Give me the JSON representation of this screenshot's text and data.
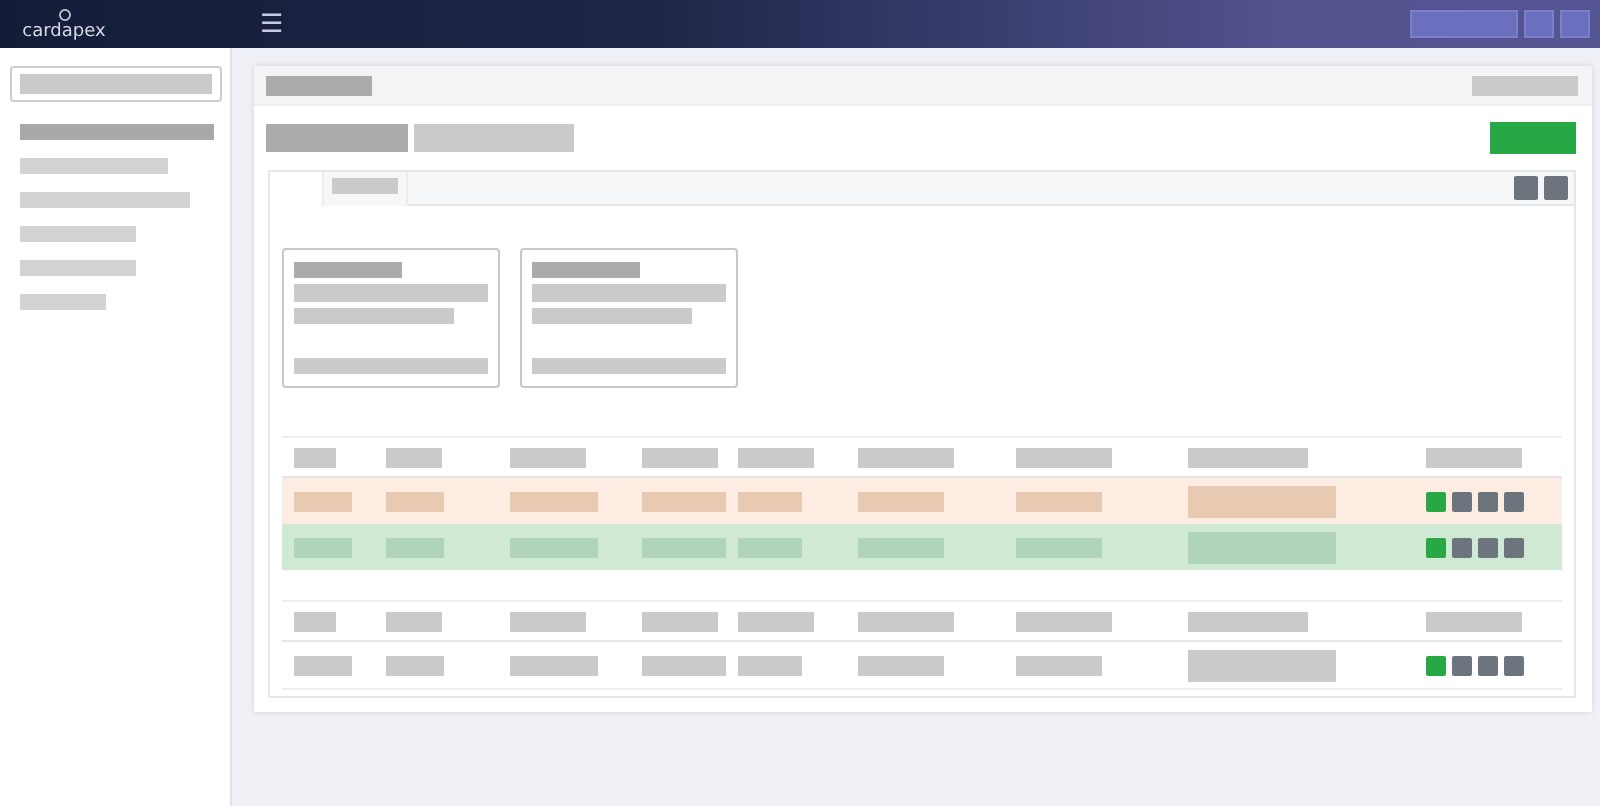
{
  "topbar": {
    "logo": "cardapex",
    "menu_icon": "☰",
    "buttons": [
      {
        "kind": "wide"
      },
      {
        "kind": "square"
      },
      {
        "kind": "square"
      }
    ]
  },
  "sidebar": {
    "search": {
      "kind": "field"
    },
    "items": [
      {
        "selected": true
      },
      {
        "selected": false
      },
      {
        "selected": false
      },
      {
        "selected": false
      },
      {
        "selected": false
      },
      {
        "selected": false
      }
    ]
  },
  "tabs": [
    {
      "selected": true
    },
    {
      "selected": false
    }
  ],
  "summary_cards": [
    {
      "kind": "card"
    },
    {
      "kind": "card"
    }
  ],
  "tables": [
    {
      "rows": [
        {
          "kind": "warning",
          "actions": [
            {
              "kind": "primary"
            },
            {
              "kind": "secondary"
            },
            {
              "kind": "secondary"
            },
            {
              "kind": "secondary"
            }
          ]
        },
        {
          "kind": "success",
          "actions": [
            {
              "kind": "primary"
            },
            {
              "kind": "secondary"
            },
            {
              "kind": "secondary"
            },
            {
              "kind": "secondary"
            }
          ]
        }
      ]
    },
    {
      "rows": [
        {
          "kind": "default",
          "actions": [
            {
              "kind": "primary"
            },
            {
              "kind": "secondary"
            },
            {
              "kind": "secondary"
            },
            {
              "kind": "secondary"
            }
          ]
        }
      ]
    }
  ]
}
